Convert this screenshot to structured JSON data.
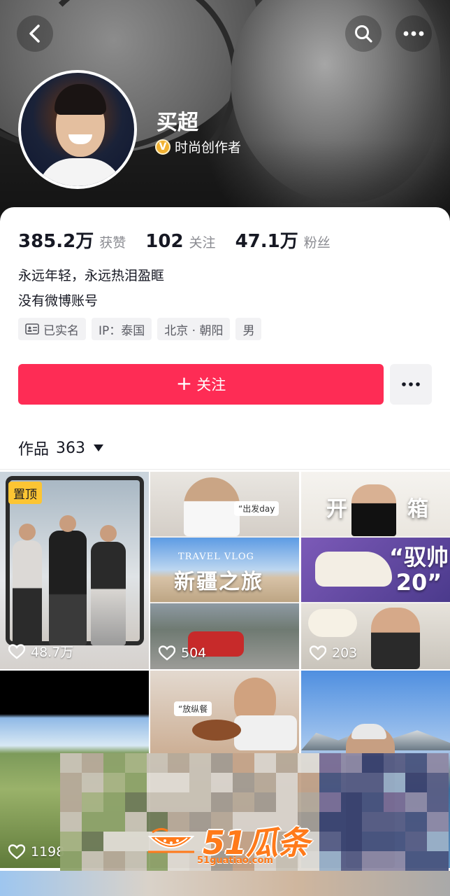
{
  "header": {
    "name": "买超",
    "verify_badge": "V",
    "verify_label": "时尚创作者"
  },
  "stats": [
    {
      "num": "385.2万",
      "label": "获赞"
    },
    {
      "num": "102",
      "label": "关注"
    },
    {
      "num": "47.1万",
      "label": "粉丝"
    }
  ],
  "bio": {
    "line1": "永远年轻，永远热泪盈眶",
    "line2": "没有微博账号"
  },
  "tags": {
    "verified": "已实名",
    "ip": "IP：泰国",
    "location": "北京 · 朝阳",
    "gender": "男"
  },
  "actions": {
    "follow_plus": "+",
    "follow_label": "关注"
  },
  "works": {
    "label": "作品",
    "count": "363"
  },
  "grid": {
    "pinned_label": "置顶",
    "likes": [
      "48.7万",
      "504",
      "203",
      "1198"
    ],
    "c2_tag": "“出发day",
    "c2_small": "TRAVEL VLOG",
    "c2_big": "新疆之旅",
    "c3_kai": "开",
    "c3_xiang": "箱",
    "c3_quote": "“驭帅 20”",
    "c5_tag": "“放纵餐"
  },
  "watermark": {
    "brand": "51瓜条",
    "url": "51guatiao.com"
  },
  "colors": {
    "accent": "#fe2c55",
    "pin": "#fcc533",
    "verify": "#f2b233",
    "watermark": "#ff7a1a"
  }
}
